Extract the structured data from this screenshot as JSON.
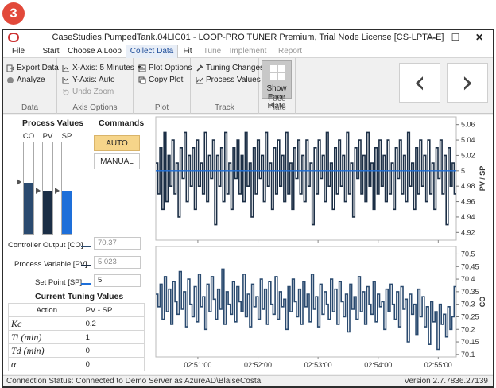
{
  "badge": "3",
  "window": {
    "title": "CaseStudies.PumpedTank.04LIC01 - LOOP-PRO TUNER Premium, Trial Node License [CS-LPTA-E]"
  },
  "menu": [
    "File",
    "Start",
    "Choose A Loop",
    "Collect Data",
    "Fit",
    "Tune",
    "Implement",
    "Report"
  ],
  "ribbon": {
    "export": "Export Data",
    "analyze": "Analyze",
    "data_group": "Data",
    "xaxis": "X-Axis: 5 Minutes",
    "yaxis": "Y-Axis: Auto",
    "undo_zoom": "Undo Zoom",
    "axis_group": "Axis Options",
    "plot_options": "Plot Options",
    "copy_plot": "Copy Plot",
    "plot_group": "Plot",
    "tuning_changes": "Tuning Changes",
    "process_values": "Process Values",
    "track_group": "Track",
    "show": "Show",
    "face_plate": "Face Plate",
    "faceplate_group": "Face Plate"
  },
  "panel": {
    "process_values_title": "Process Values",
    "commands_title": "Commands",
    "co": "CO",
    "pv": "PV",
    "sp": "SP",
    "auto": "AUTO",
    "manual": "MANUAL",
    "co_label": "Controller Output [CO]",
    "co_value": "70.37",
    "pv_label": "Process Variable [PV]",
    "pv_value": "5.023",
    "sp_label": "Set Point [SP]",
    "sp_value": "5",
    "co_level": 0.56,
    "pv_level": 0.47,
    "sp_level": 0.47,
    "tuning_title": "Current Tuning Values",
    "tuning_header": [
      "Action",
      "PV - SP"
    ],
    "tuning_rows": [
      [
        "Kc",
        "0.2"
      ],
      [
        "Ti (min)",
        "1"
      ],
      [
        "Td (min)",
        "0"
      ],
      [
        "α",
        "0"
      ]
    ]
  },
  "colors": {
    "pv": "#1b2e45",
    "co": "#2a4a6f",
    "sp": "#1e6fd9",
    "active_cmd": "#f6d58a"
  },
  "chart_data": [
    {
      "type": "line",
      "x": [
        "02:51:00",
        "02:52:00",
        "02:53:00",
        "02:54:00",
        "02:55:00"
      ],
      "ylabel": "PV / SP",
      "ylim": [
        4.91,
        5.07
      ],
      "yticks": [
        4.92,
        4.94,
        4.96,
        4.98,
        5,
        5.02,
        5.04,
        5.06
      ],
      "series": [
        {
          "name": "PV",
          "step": true,
          "values": [
            5.01,
            4.97,
            5.03,
            4.95,
            5.05,
            4.96,
            5.02,
            4.98,
            5.04,
            4.97,
            5.01,
            4.94,
            5.03,
            4.99,
            5.05,
            4.96,
            5.02,
            4.98,
            5.03,
            4.95,
            5.04,
            4.98,
            5.01,
            4.97,
            5.05,
            4.96,
            5.02,
            4.99,
            5.04,
            4.93,
            5.02,
            4.98,
            5.03,
            4.96,
            5.05,
            4.97,
            5.01,
            4.95,
            5.03,
            4.99,
            5.04,
            4.97,
            5.02,
            4.96,
            5.05,
            4.98,
            5.01,
            4.94,
            5.03,
            4.97,
            5.04,
            4.99,
            5.02,
            4.96,
            5.05,
            4.98,
            5.01,
            4.95,
            5.03,
            4.97,
            5.04,
            4.98,
            5.02,
            4.96,
            5.05,
            4.97,
            5.01,
            4.95,
            5.03,
            4.99,
            5.04,
            4.97,
            5.02,
            4.96,
            5.04,
            4.98,
            5.01,
            4.93,
            5.03,
            4.97,
            5.04,
            4.99,
            5.02,
            4.96,
            5.05,
            4.98,
            5.01,
            4.95,
            5.03,
            4.97,
            5.04,
            4.98,
            5.02,
            4.96,
            5.05,
            4.97,
            5.01,
            4.94,
            5.03,
            4.99,
            5.04,
            4.97,
            5.02,
            4.96,
            5.05,
            4.98,
            5.01,
            4.95,
            5.03,
            4.97,
            5.04,
            4.98,
            5.02,
            4.96,
            5.04,
            4.97,
            5.01,
            4.95,
            5.03,
            4.99,
            5.04,
            4.97,
            5.02,
            4.96,
            5.05,
            4.98,
            5.01,
            4.95,
            5.03,
            4.97,
            5.04,
            4.98,
            5.02,
            4.96,
            5.04,
            4.97,
            5.01,
            4.95,
            5.03,
            4.99,
            5.04,
            4.97,
            5.02,
            4.93,
            5.03,
            4.98,
            5.01,
            4.97
          ]
        },
        {
          "name": "SP",
          "step": false,
          "values": [
            5,
            5
          ]
        }
      ]
    },
    {
      "type": "line",
      "x": [
        "02:51:00",
        "02:52:00",
        "02:53:00",
        "02:54:00",
        "02:55:00"
      ],
      "ylabel": "CO",
      "ylim": [
        70.09,
        70.53
      ],
      "yticks": [
        70.1,
        70.15,
        70.2,
        70.25,
        70.3,
        70.35,
        70.4,
        70.45,
        70.5
      ],
      "series": [
        {
          "name": "CO",
          "step": true,
          "values": [
            70.34,
            70.29,
            70.38,
            70.24,
            70.41,
            70.27,
            70.36,
            70.22,
            70.39,
            70.31,
            70.26,
            70.43,
            70.28,
            70.35,
            70.21,
            70.4,
            70.3,
            70.25,
            70.37,
            70.23,
            70.42,
            70.29,
            70.33,
            70.2,
            70.38,
            70.27,
            70.41,
            70.32,
            70.24,
            70.36,
            70.28,
            70.44,
            70.22,
            70.35,
            70.3,
            70.26,
            70.39,
            70.23,
            70.37,
            70.31,
            70.27,
            70.42,
            70.25,
            70.34,
            70.21,
            70.38,
            70.29,
            70.33,
            70.24,
            70.4,
            70.28,
            70.36,
            70.22,
            70.39,
            70.3,
            70.26,
            70.41,
            70.24,
            70.35,
            70.29,
            70.32,
            70.2,
            70.37,
            70.27,
            70.4,
            70.31,
            70.25,
            70.36,
            70.22,
            70.39,
            70.29,
            70.34,
            70.23,
            70.42,
            70.28,
            70.33,
            70.21,
            70.38,
            70.26,
            70.35,
            70.3,
            70.24,
            70.4,
            70.27,
            70.36,
            70.22,
            70.39,
            70.31,
            70.25,
            70.34,
            70.19,
            70.38,
            70.28,
            70.33,
            70.24,
            70.41,
            70.27,
            70.35,
            70.22,
            70.37,
            70.3,
            70.26,
            70.39,
            70.23,
            70.34,
            70.29,
            70.31,
            70.2,
            70.36,
            70.27,
            70.38,
            70.3,
            70.24,
            70.35,
            70.21,
            70.37,
            70.28,
            70.32,
            70.15,
            70.34,
            70.26,
            70.3,
            70.18,
            70.36,
            70.25,
            70.33,
            70.21,
            70.29,
            70.14,
            70.31,
            70.23,
            70.27,
            70.12,
            70.3,
            70.22,
            70.26,
            70.17,
            70.29,
            70.2,
            70.25,
            70.37
          ]
        }
      ]
    }
  ],
  "status": {
    "left": "Connection Status: Connected to Demo Server as AzureAD\\BlaiseCosta",
    "right": "Version 2.7.7836.27139"
  }
}
